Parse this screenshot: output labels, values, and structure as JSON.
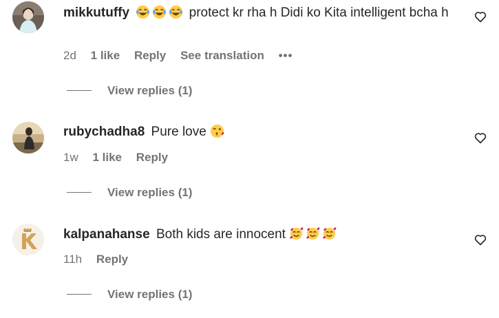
{
  "comments": [
    {
      "username": "mikkutuffy",
      "emojis": [
        "laughing-tears-emoji",
        "laughing-tears-emoji",
        "laughing-tears-emoji"
      ],
      "text": "protect kr rha h Didi ko Kita intelligent bcha h",
      "emoji_position": "before",
      "time": "2d",
      "likes": "1 like",
      "reply": "Reply",
      "translation": "See translation",
      "more": "•••",
      "view_replies": "View replies (1)"
    },
    {
      "username": "rubychadha8",
      "text": "Pure love",
      "emojis": [
        "kiss-heart-emoji"
      ],
      "emoji_position": "after",
      "time": "1w",
      "likes": "1 like",
      "reply": "Reply",
      "view_replies": "View replies (1)"
    },
    {
      "username": "kalpanahanse",
      "text": "Both kids are innocent",
      "emojis": [
        "smiling-hearts-emoji",
        "smiling-hearts-emoji",
        "smiling-hearts-emoji"
      ],
      "emoji_position": "after",
      "time": "11h",
      "reply": "Reply",
      "view_replies": "View replies (1)"
    }
  ],
  "colors": {
    "text": "#262626",
    "secondary": "#737373",
    "avatar_k": "#d4a25a"
  }
}
